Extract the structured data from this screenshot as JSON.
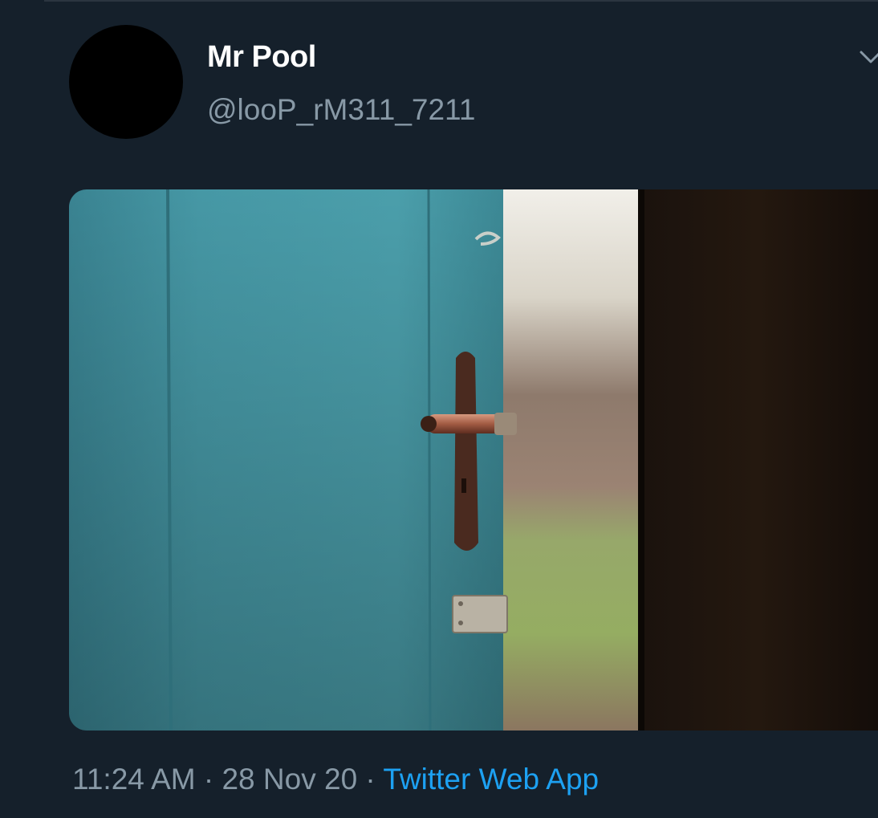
{
  "tweet": {
    "display_name": "Mr Pool",
    "handle": "@looP_rM311_7211",
    "time": "11:24 AM",
    "separator": " · ",
    "date": "28 Nov 20",
    "source": "Twitter Web App",
    "media": {
      "subject": "blue wooden door opening onto garden"
    }
  },
  "icons": {
    "more": "chevron-down-icon"
  },
  "colors": {
    "background": "#15202b",
    "name": "#ffffff",
    "secondary": "#8899a6",
    "link": "#1da1f2"
  }
}
